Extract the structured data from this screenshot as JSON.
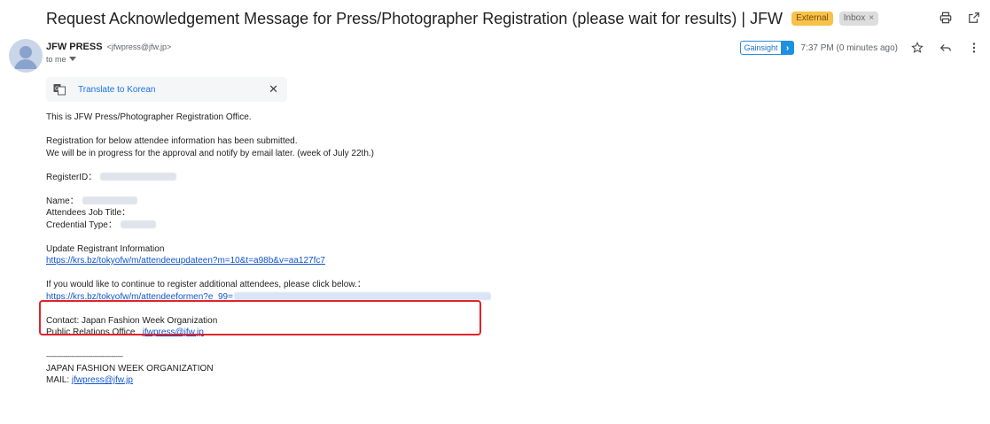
{
  "email": {
    "subject": "Request Acknowledgement Message for Press/Photographer Registration (please wait for results) | JFW",
    "labels": {
      "external": "External",
      "inbox": "Inbox"
    },
    "sender": {
      "name": "JFW PRESS",
      "email": "<jfwpress@jfw.jp>"
    },
    "to": "to me",
    "gainsight": "Gainsight",
    "time": "7:37 PM (0 minutes ago)",
    "translate": {
      "label": "Translate to Korean"
    }
  },
  "body": {
    "line1": "This is JFW Press/Photographer Registration Office.",
    "line2": "Registration for below attendee information has been submitted.",
    "line3": "We will be in progress for the approval and notify by email later. (week of July 22th.)",
    "register_id_label": "RegisterID：",
    "name_label": "Name：",
    "job_title_label": "Attendees Job Title：",
    "credential_label": "Credential Type：",
    "update_label": "Update Registrant Information",
    "update_url": "https://krs.bz/tokyofw/m/attendeeupdateen?m=10&t=a98b&v=aa127fc7",
    "continue_label": "If you would like to continue to register additional attendees, please click below.：",
    "continue_url": "https://krs.bz/tokyofw/m/attendeeformen?e_99=",
    "contact_line": "Contact: Japan Fashion Week Organization",
    "pr_label": "Public Relations Office",
    "pr_email": "jfwpress@jfw.jp",
    "separator": "----------------------------------------",
    "org_name": "JAPAN FASHION WEEK ORGANIZATION",
    "mail_label": "MAIL: ",
    "mail_email": "jfwpress@jfw.jp"
  },
  "colors": {
    "link": "#1155cc",
    "highlight": "#e0242a",
    "external_label": "#f7c24a"
  }
}
